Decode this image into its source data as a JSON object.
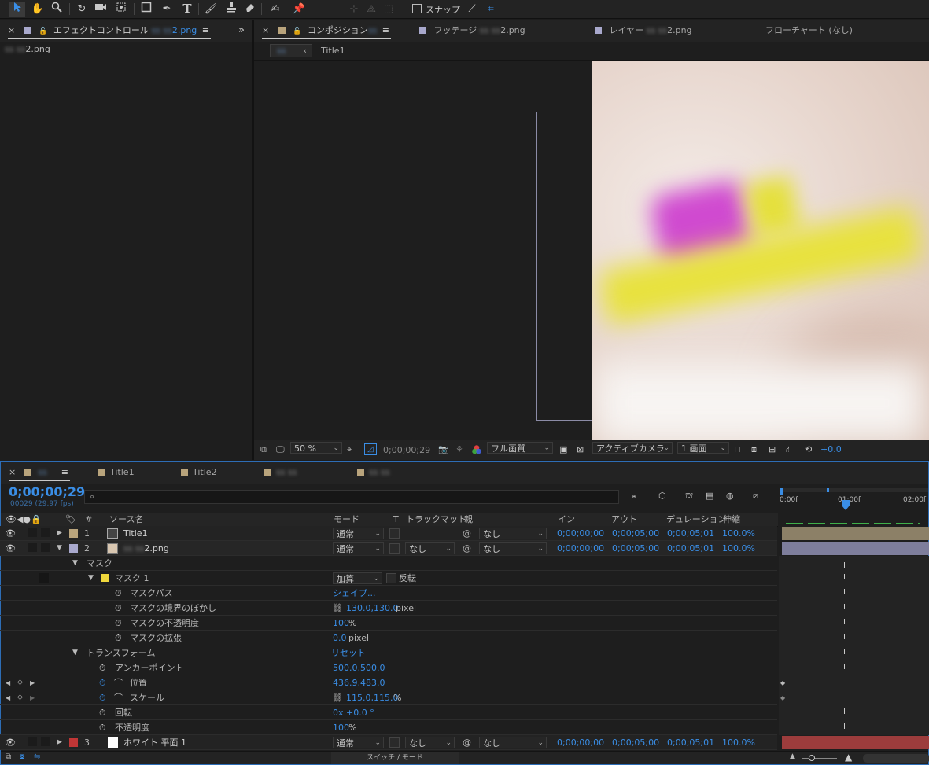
{
  "toolbar": {
    "snap_label": "スナップ",
    "tools": [
      "selection-tool-icon",
      "hand-tool-icon",
      "zoom-tool-icon",
      "rotate-tool-icon",
      "camera-tool-icon",
      "pan-behind-tool-icon",
      "rectangle-tool-icon",
      "pen-tool-icon",
      "text-tool-icon",
      "brush-tool-icon",
      "clone-stamp-tool-icon",
      "eraser-tool-icon",
      "roto-brush-tool-icon",
      "puppet-pin-tool-icon"
    ]
  },
  "effects_panel": {
    "tab_label": "エフェクトコントロール",
    "tab_file": "2.png",
    "layer_label": "2.png"
  },
  "viewer": {
    "tabs": [
      {
        "label": "コンポジション"
      },
      {
        "label": "フッテージ",
        "file": "2.png"
      },
      {
        "label": "レイヤー",
        "file": "2.png"
      },
      {
        "label": "フローチャート (なし)"
      }
    ],
    "breadcrumb": "Title1",
    "bottom": {
      "zoom": "50 %",
      "timecode": "0;00;00;29",
      "quality": "フル画質",
      "camera": "アクティブカメラ",
      "view": "1 画面",
      "exposure": "+0.0"
    }
  },
  "timeline": {
    "tabs": [
      "Title1",
      "Title2"
    ],
    "timecode": "0;00;00;29",
    "fps": "00029 (29.97 fps)",
    "search_placeholder": "",
    "headers": {
      "num": "#",
      "source": "ソース名",
      "mode": "モード",
      "t": "T",
      "trackmatte": "トラックマット",
      "parent": "親",
      "in": "イン",
      "out": "アウト",
      "duration": "デュレーション",
      "stretch": "伸縮"
    },
    "ruler": {
      "t0": "0:00f",
      "t1": "01:00f",
      "t2": "02:00f"
    },
    "layers": [
      {
        "num": "1",
        "name": "Title1",
        "mode": "通常",
        "matte": "",
        "parent": "なし",
        "in": "0;00;00;00",
        "out": "0;00;05;00",
        "dur": "0;00;05;01",
        "stretch": "100.0%",
        "color": "#b9a47c"
      },
      {
        "num": "2",
        "name": "2.png",
        "mode": "通常",
        "matte": "なし",
        "parent": "なし",
        "in": "0;00;00;00",
        "out": "0;00;05;00",
        "dur": "0;00;05;01",
        "stretch": "100.0%",
        "color": "#a8a8cc"
      },
      {
        "num": "3",
        "name": "ホワイト 平面 1",
        "mode": "通常",
        "matte": "なし",
        "parent": "なし",
        "in": "0;00;00;00",
        "out": "0;00;05;00",
        "dur": "0;00;05;01",
        "stretch": "100.0%",
        "color": "#c03636"
      }
    ],
    "props": {
      "mask_group": "マスク",
      "mask1": "マスク 1",
      "mask1_mode": "加算",
      "invert": "反転",
      "mask_path": "マスクパス",
      "mask_path_val": "シェイプ...",
      "feather": "マスクの境界のぼかし",
      "feather_val": "130.0,130.0",
      "feather_unit": "pixel",
      "mask_opacity": "マスクの不透明度",
      "mask_opacity_val": "100",
      "mask_opacity_unit": "%",
      "expansion": "マスクの拡張",
      "expansion_val": "0.0",
      "expansion_unit": "pixel",
      "transform": "トランスフォーム",
      "reset": "リセット",
      "anchor": "アンカーポイント",
      "anchor_val": "500.0,500.0",
      "position": "位置",
      "position_val": "436.9,483.0",
      "scale": "スケール",
      "scale_val": "115.0,115.0",
      "scale_unit": "%",
      "rotation": "回転",
      "rotation_val": "0x +0.0 °",
      "opacity": "不透明度",
      "opacity_val": "100",
      "opacity_unit": "%"
    },
    "footer_label": "スイッチ / モード"
  }
}
